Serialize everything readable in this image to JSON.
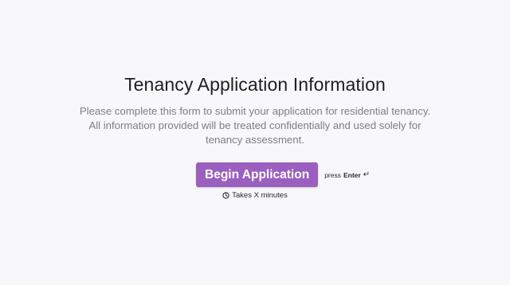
{
  "welcome": {
    "title": "Tenancy Application Information",
    "description": "Please complete this form to submit your application for residential tenancy. All information provided will be treated confidentially and used solely for tenancy assessment.",
    "begin_button_label": "Begin Application",
    "press_label": "press",
    "enter_key_label": "Enter",
    "enter_icon": "enter-return-icon",
    "time_estimate": "Takes X minutes",
    "time_icon": "clock-icon"
  },
  "colors": {
    "background": "#f8f8fa",
    "accent": "#9b5fbf",
    "description_text": "#7d7d84"
  }
}
